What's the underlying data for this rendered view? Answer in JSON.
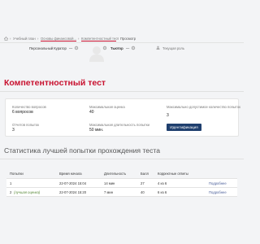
{
  "breadcrumb": {
    "items": [
      "Учебный план",
      "Основы финансовой...",
      "Компетентностный тест",
      "Просмотр"
    ]
  },
  "profile": {
    "curator_label": "Персональный Куратор",
    "curator_value": "―",
    "tutor_label": "Тьютор",
    "tutor_value": "―",
    "current_role_label": "Текущая роль"
  },
  "page_title": "Компетентностный тест",
  "info": {
    "questions_label": "Количество вопросов",
    "questions_value": "6 вопросов",
    "max_score_label": "Максимальная оценка",
    "max_score_value": "40",
    "max_attempts_label": "Максимально допустимое количество попыток",
    "max_attempts_value": "3",
    "attempts_used_label": "Отчетов попыток",
    "attempts_used_value": "3",
    "max_duration_label": "Максимальная длительность попытки",
    "max_duration_value": "50 мин.",
    "identify_button": "Идентификация"
  },
  "stats": {
    "title": "Статистика лучшей попытки прохождения теста",
    "columns": [
      "Попытки",
      "Время начала",
      "Длительность",
      "Балл",
      "Корректные ответы",
      ""
    ],
    "rows": [
      {
        "num": "1",
        "note": "",
        "start": "22-07-2024 15:04",
        "duration": "14 мин",
        "score": "27",
        "correct": "4 из 6",
        "details": "Подробнее"
      },
      {
        "num": "2",
        "note": "(лучшая оценка)",
        "start": "22-07-2024 15:20",
        "duration": "7 мин",
        "score": "40",
        "correct": "6 из 6",
        "details": "Подробнее"
      }
    ]
  },
  "colors": {
    "accent": "#c8102e",
    "button": "#1f3f6e",
    "link": "#4a5f9a"
  }
}
